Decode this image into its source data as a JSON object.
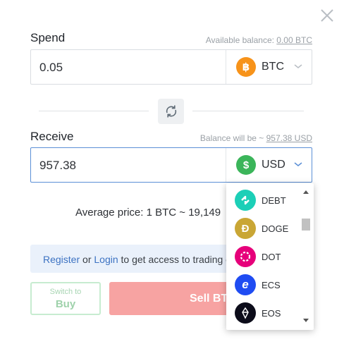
{
  "close_icon": "close-icon",
  "spend": {
    "label": "Spend",
    "balance_prefix": "Available balance: ",
    "balance_value": "0.00 BTC",
    "amount": "0.05",
    "currency": "BTC",
    "currency_symbol": "฿",
    "currency_color": "#f7931a"
  },
  "swap_icon": "swap-icon",
  "receive": {
    "label": "Receive",
    "balance_prefix": "Balance will be ~ ",
    "balance_value": "957.38 USD",
    "amount": "957.38",
    "currency": "USD",
    "currency_symbol": "$",
    "currency_color": "#3bb55a"
  },
  "average_price": "Average price: 1 BTC ~ 19,149",
  "info": {
    "register": "Register",
    "or": " or ",
    "login": "Login",
    "rest": " to get access to trading o"
  },
  "switch_button": {
    "top": "Switch to",
    "bottom": "Buy"
  },
  "sell_button": "Sell BTC",
  "dropdown": {
    "items": [
      {
        "code": "DEBT",
        "symbol": "⟡",
        "color": "#1ccfb7"
      },
      {
        "code": "DOGE",
        "symbol": "Đ",
        "color": "#c9a635"
      },
      {
        "code": "DOT",
        "symbol": "●",
        "color": "#e6007a"
      },
      {
        "code": "ECS",
        "symbol": "e",
        "color": "#1f4cf2"
      },
      {
        "code": "EOS",
        "symbol": "◇",
        "color": "#0c0c1a"
      }
    ]
  }
}
